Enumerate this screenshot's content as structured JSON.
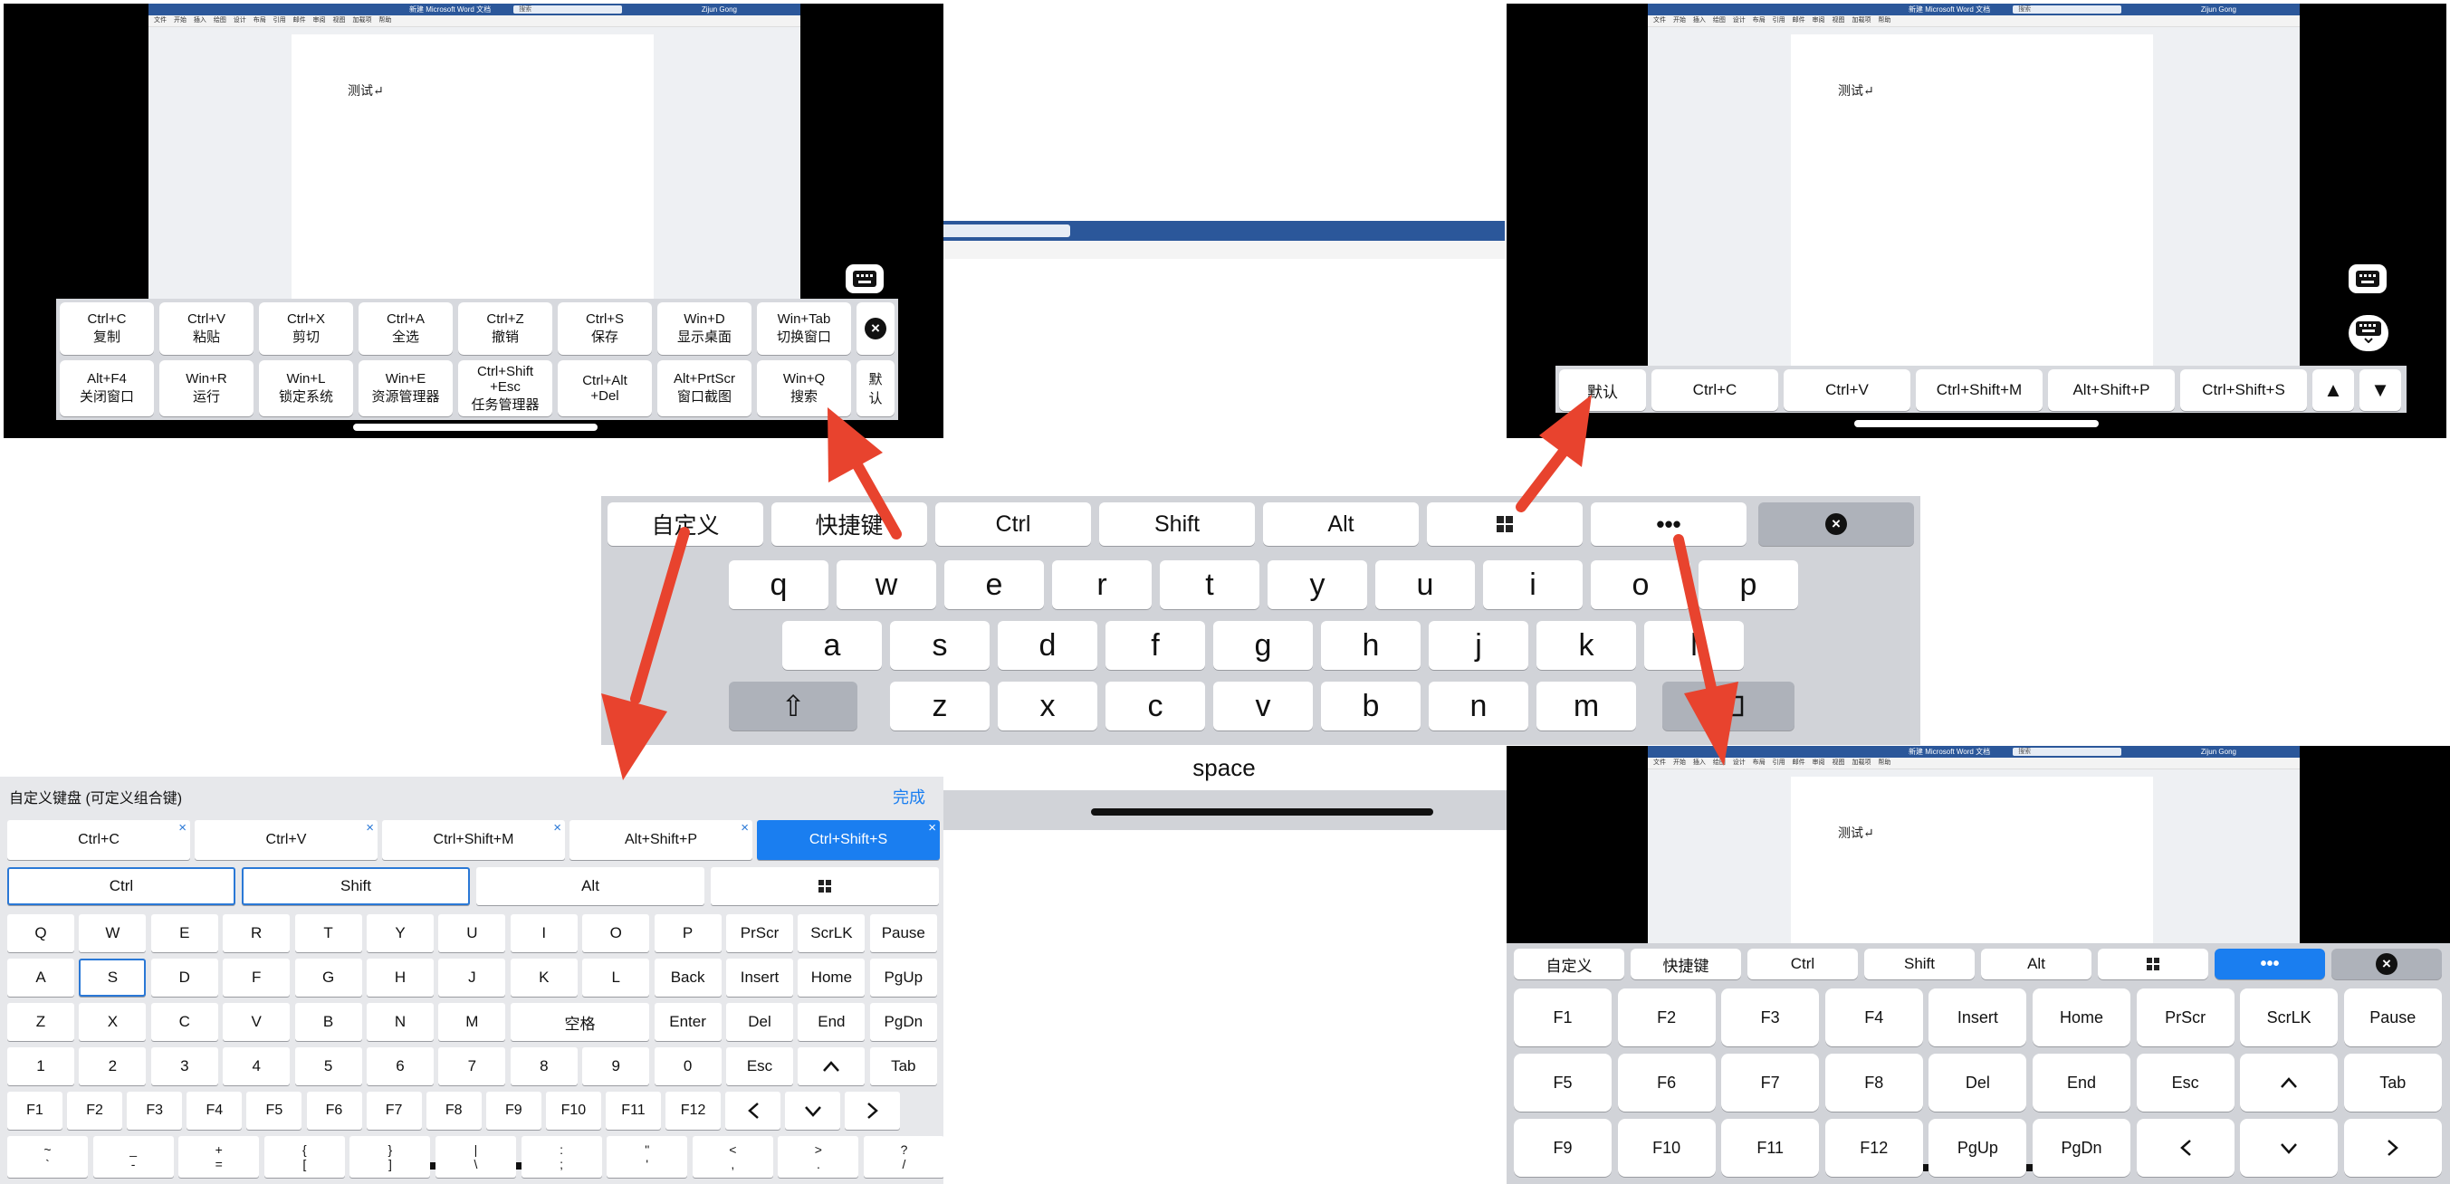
{
  "word": {
    "title": "新建 Microsoft Word 文档",
    "search": "搜索",
    "user": "Zijun Gong",
    "ribbon_small": "文件 开始 插入 绘图 设计 布局 引用 邮件 审阅 视图 加载项 帮助",
    "ribbon_center": [
      "设计",
      "布局",
      "引用",
      "邮件",
      "审阅",
      "视图",
      "加载项",
      "帮助"
    ],
    "doc_text": "测试↵"
  },
  "top_left": {
    "row1": [
      "Ctrl+C\n复制",
      "Ctrl+V\n粘贴",
      "Ctrl+X\n剪切",
      "Ctrl+A\n全选",
      "Ctrl+Z\n撤销",
      "Ctrl+S\n保存",
      "Win+D\n显示桌面",
      "Win+Tab\n切换窗口"
    ],
    "row2": [
      "Alt+F4\n关闭窗口",
      "Win+R\n运行",
      "Win+L\n锁定系统",
      "Win+E\n资源管理器",
      "Ctrl+Shift\n+Esc\n任务管理器",
      "Ctrl+Alt\n+Del",
      "Alt+PrtScr\n窗口截图",
      "Win+Q\n搜索"
    ],
    "default_key": "默\n认"
  },
  "top_right": {
    "keys": [
      "默认",
      "Ctrl+C",
      "Ctrl+V",
      "Ctrl+Shift+M",
      "Alt+Shift+P",
      "Ctrl+Shift+S"
    ],
    "up": "▲",
    "down": "▼"
  },
  "center": {
    "toolbar": [
      "自定义",
      "快捷键",
      "Ctrl",
      "Shift",
      "Alt",
      "win",
      "•••"
    ],
    "row1": [
      "q",
      "w",
      "e",
      "r",
      "t",
      "y",
      "u",
      "i",
      "o",
      "p"
    ],
    "row2": [
      "a",
      "s",
      "d",
      "f",
      "g",
      "h",
      "j",
      "k",
      "l"
    ],
    "row3": [
      "z",
      "x",
      "c",
      "v",
      "b",
      "n",
      "m"
    ],
    "shift_icon": "⇧",
    "space": "space"
  },
  "bottom_left": {
    "title": "自定义键盘 (可定义组合键)",
    "done": "完成",
    "combos": [
      "Ctrl+C",
      "Ctrl+V",
      "Ctrl+Shift+M",
      "Alt+Shift+P",
      "Ctrl+Shift+S"
    ],
    "modifiers": [
      "Ctrl",
      "Shift",
      "Alt",
      "win"
    ],
    "row_q": [
      "Q",
      "W",
      "E",
      "R",
      "T",
      "Y",
      "U",
      "I",
      "O",
      "P",
      "PrScr",
      "ScrLK",
      "Pause"
    ],
    "row_a": [
      "A",
      "S",
      "D",
      "F",
      "G",
      "H",
      "J",
      "K",
      "L",
      "Back",
      "Insert",
      "Home",
      "PgUp"
    ],
    "row_z": [
      "Z",
      "X",
      "C",
      "V",
      "B",
      "N",
      "M",
      "空格",
      "Enter",
      "Del",
      "End",
      "PgDn"
    ],
    "row_num": [
      "1",
      "2",
      "3",
      "4",
      "5",
      "6",
      "7",
      "8",
      "9",
      "0",
      "Esc",
      "^",
      "Tab"
    ],
    "row_f": [
      "F1",
      "F2",
      "F3",
      "F4",
      "F5",
      "F6",
      "F7",
      "F8",
      "F9",
      "F10",
      "F11",
      "F12",
      "<",
      "v",
      ">"
    ],
    "row_sym": [
      "~\n`",
      "_\n-",
      "+\n=",
      "{\n[",
      "}\n]",
      "|\n\\",
      ":\n;",
      "\"\n'",
      "<\n,",
      ">\n.",
      "?\n/"
    ]
  },
  "bottom_right": {
    "toolbar": [
      "自定义",
      "快捷键",
      "Ctrl",
      "Shift",
      "Alt",
      "win",
      "•••"
    ],
    "row1": [
      "F1",
      "F2",
      "F3",
      "F4",
      "Insert",
      "Home",
      "PrScr",
      "ScrLK",
      "Pause"
    ],
    "row2": [
      "F5",
      "F6",
      "F7",
      "F8",
      "Del",
      "End",
      "Esc",
      "^",
      "Tab"
    ],
    "row3": [
      "F9",
      "F10",
      "F11",
      "F12",
      "PgUp",
      "PgDn",
      "<",
      "v",
      ">"
    ]
  },
  "colors": {
    "accent": "#1a7ef0",
    "arrow": "#e8432e",
    "keyboard_bg": "#d1d3d8",
    "word_blue": "#2b579a"
  }
}
